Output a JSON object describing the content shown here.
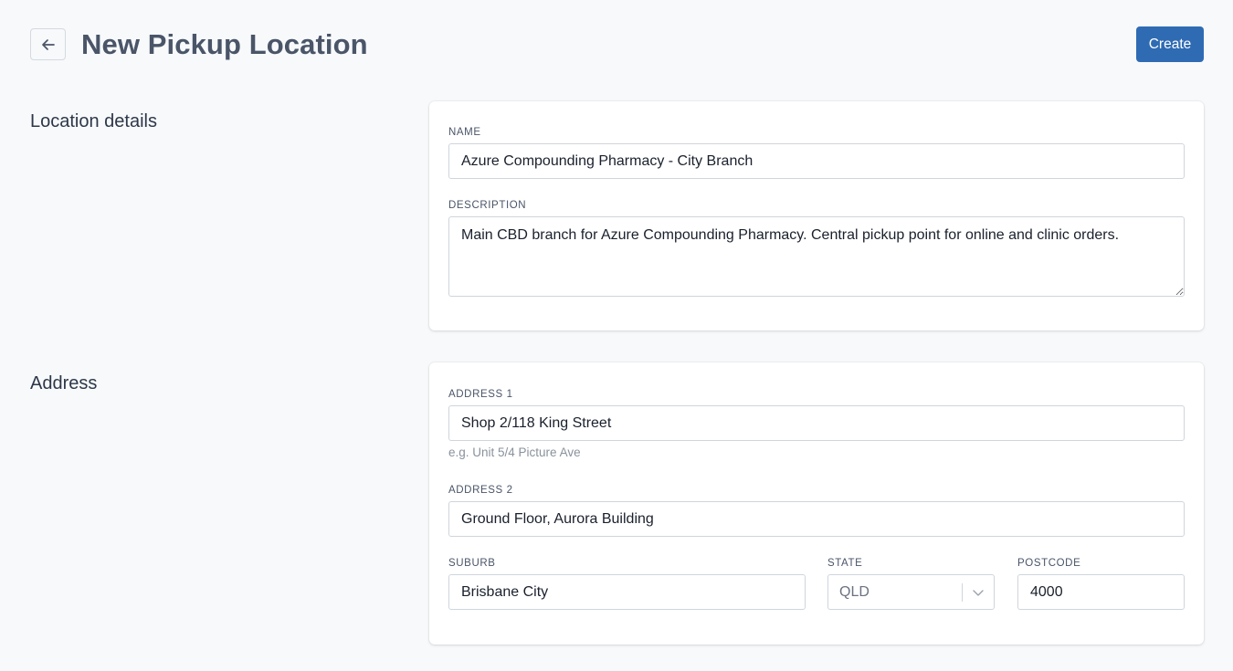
{
  "header": {
    "title": "New Pickup Location",
    "create_label": "Create"
  },
  "location_details": {
    "section_title": "Location details",
    "name_label": "NAME",
    "name_value": "Azure Compounding Pharmacy - City Branch",
    "description_label": "DESCRIPTION",
    "description_value": "Main CBD branch for Azure Compounding Pharmacy. Central pickup point for online and clinic orders."
  },
  "address": {
    "section_title": "Address",
    "address1_label": "ADDRESS 1",
    "address1_value": "Shop 2/118 King Street",
    "address1_hint": "e.g. Unit 5/4 Picture Ave",
    "address2_label": "ADDRESS 2",
    "address2_value": "Ground Floor, Aurora Building",
    "suburb_label": "SUBURB",
    "suburb_value": "Brisbane City",
    "state_label": "STATE",
    "state_value": "QLD",
    "postcode_label": "POSTCODE",
    "postcode_value": "4000"
  },
  "colors": {
    "primary": "#2f6bb3",
    "background": "#f7f9fb",
    "card": "#ffffff"
  },
  "icons": {
    "back": "arrow-left-icon",
    "state_dropdown": "chevron-down-icon"
  }
}
